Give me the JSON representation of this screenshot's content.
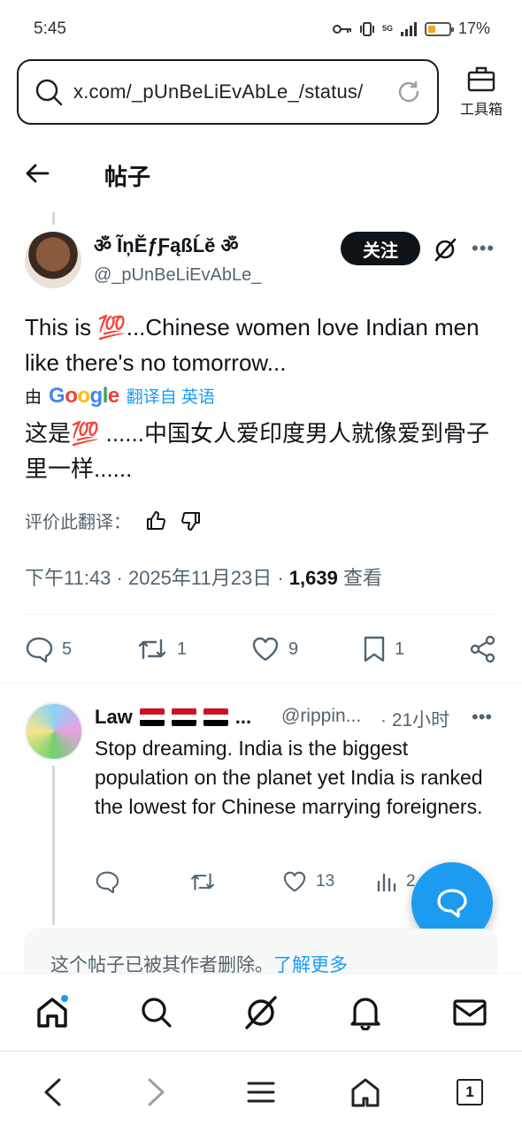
{
  "status_bar": {
    "time": "5:45",
    "signal_label": "5G",
    "battery": "17%",
    "battery_level": 0.17
  },
  "browser": {
    "url": "x.com/_pUnBeLiEvAbLe_/status/",
    "toolbox_label": "工具箱",
    "tab_count": "1"
  },
  "header": {
    "title": "帖子"
  },
  "post": {
    "display_name": "ॐ ĨņĔƒƑąßĹĕ ॐ",
    "handle": "@_pUnBeLiEvAbLe_",
    "follow_label": "关注",
    "text_before_emoji": "This is ",
    "emoji": "💯",
    "text_after_emoji": "...Chinese women love Indian men like there's no tomorrow...",
    "translated_by": "由",
    "translator": "Google",
    "translated_from": "翻译自 英语",
    "translated_before_emoji": "这是",
    "translated_after_emoji": " ......中国女人爱印度男人就像爱到骨子里一样......",
    "rate_translation": "评价此翻译：",
    "time": "下午11:43 · 2025年11月23日 · ",
    "views": "1,639",
    "views_label": " 查看",
    "replies": "5",
    "reposts": "1",
    "likes": "9",
    "bookmarks": "1"
  },
  "reply": {
    "name": "Law",
    "handle": "@rippin...",
    "time": "· 21小时",
    "text": "Stop dreaming. India is the biggest population on the planet yet India is ranked the lowest for Chinese marrying foreigners.",
    "replies": "",
    "reposts": "",
    "likes": "13",
    "views": "2"
  },
  "deleted_notice": {
    "text": "这个帖子已被其作者删除。",
    "link": "了解更多"
  },
  "colors": {
    "accent": "#1d9bf0",
    "text": "#0f1419",
    "secondary": "#536471"
  }
}
